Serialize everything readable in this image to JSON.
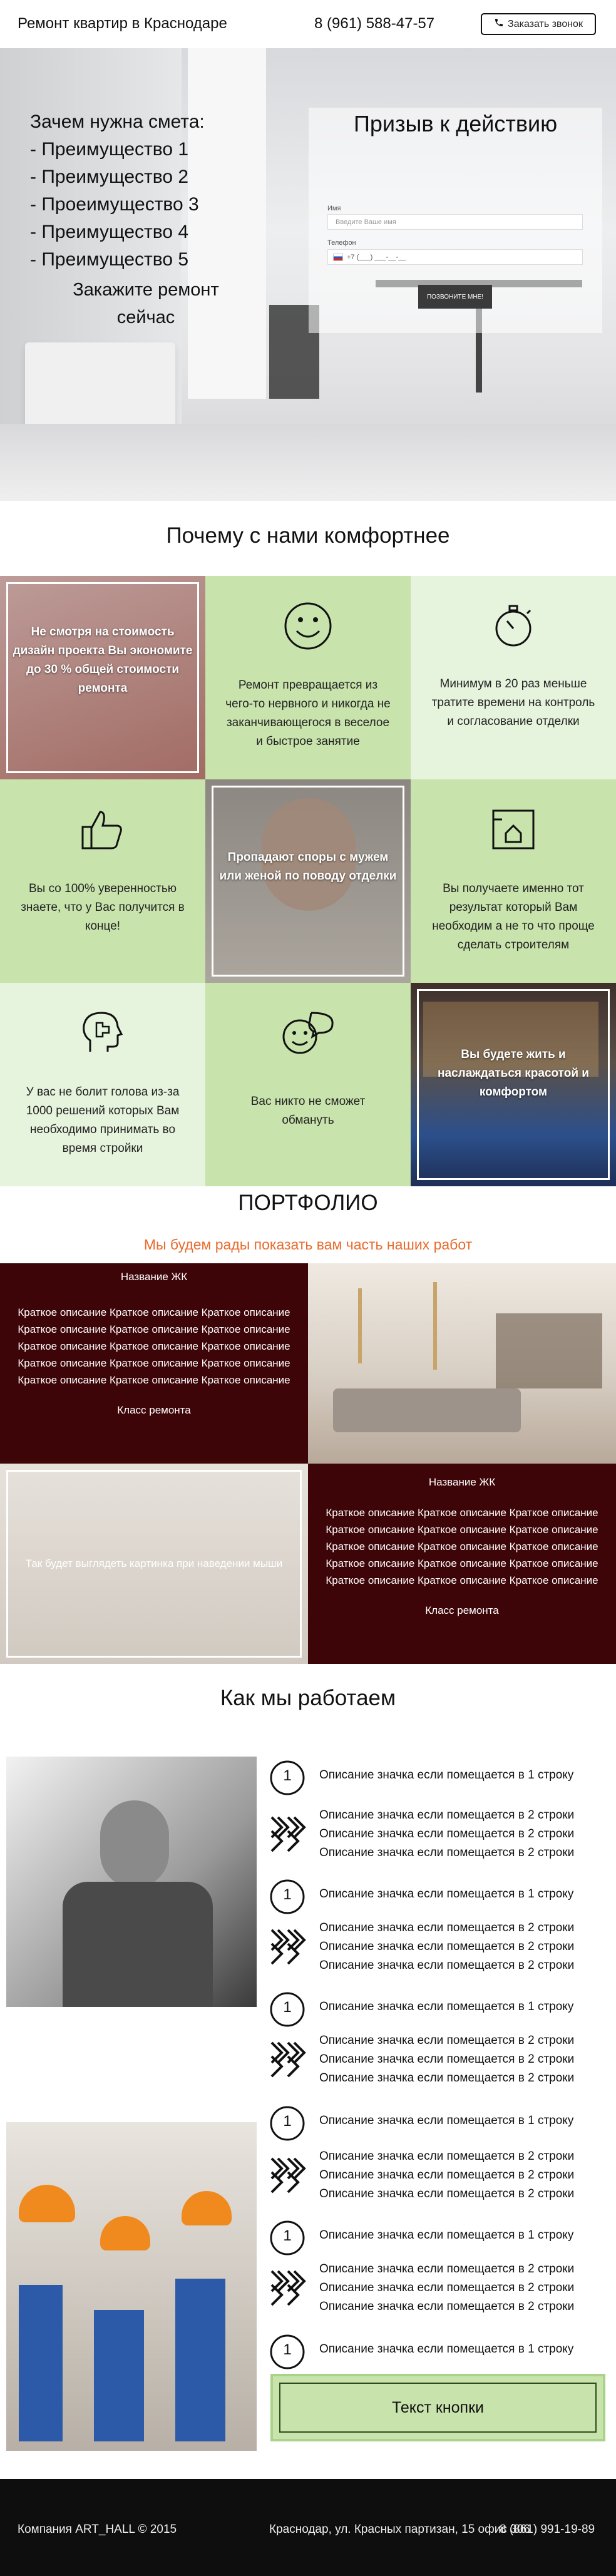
{
  "header": {
    "brand": "Ремонт квартир в Краснодаре",
    "phone": "8 (961) 588-47-57",
    "call_button": "Заказать звонок"
  },
  "hero": {
    "reasons_title": "Зачем нужна смета:",
    "reasons": [
      "- Преимущество 1",
      "- Преимущество 2",
      "- Проеимущество 3",
      "- Преимущество 4",
      "- Преимущество 5"
    ],
    "order_text": "Закажите ремонт сейчас",
    "cta": {
      "title": "Призыв к действию",
      "name_label": "Имя",
      "name_placeholder": "Введите Ваше имя",
      "phone_label": "Телефон",
      "phone_placeholder": "+7 (___) ___-__-__",
      "submit": "ПОЗВОНИТЕ МНЕ!"
    }
  },
  "why": {
    "title": "Почему с нами комфортнее",
    "cells": [
      "Не смотря на стоимость дизайн проекта Вы экономите до 30 % общей стоимости ремонта",
      "Ремонт превращается из чего-то нервного и никогда не заканчивающегося в веселое и быстрое занятие",
      "Минимум в 20 раз меньше тратите времени на контроль и согласование отделки",
      "Вы со 100% уверенностью знаете, что у Вас получится в конце!",
      "Пропадают споры с мужем или женой по поводу отделки",
      "Вы получаете именно тот результат который Вам необходим а не то что проще сделать строителям",
      "У вас не болит голова из-за 1000 решений которых Вам необходимо принимать во время стройки",
      "Вас никто не сможет обмануть",
      "Вы будете жить и наслаждаться красотой и комфортом"
    ],
    "colors": {
      "light": "#e6f3dd",
      "medium": "#c8e3ac",
      "dark_accent": "#6d1b1e"
    }
  },
  "portfolio": {
    "title": "ПОРТФОЛИО",
    "subtitle": "Мы будем рады показать вам часть наших работ",
    "items": [
      {
        "name": "Название ЖК",
        "desc_lines": [
          "Краткое описание Краткое описание Краткое описание",
          "Краткое описание Краткое описание Краткое описание",
          "Краткое описание Краткое описание Краткое описание",
          "Краткое описание Краткое описание Краткое описание",
          "Краткое описание Краткое описание Краткое описание"
        ],
        "class": "Класс ремонта"
      },
      {
        "name": "Название ЖК",
        "desc_lines": [
          "Краткое описание Краткое описание Краткое описание",
          "Краткое описание Краткое описание Краткое описание",
          "Краткое описание Краткое описание Краткое описание",
          "Краткое описание Краткое описание Краткое описание",
          "Краткое описание Краткое описание Краткое описание"
        ],
        "class": "Класс ремонта"
      }
    ],
    "hover_caption": "Так будет выглядеть картинка при наведении мыши",
    "accent": "#3d0508"
  },
  "how": {
    "title": "Как мы работаем",
    "steps": [
      {
        "icon": "number-1-icon",
        "lines": [
          "Описание значка если помещается в 1 строку"
        ]
      },
      {
        "icon": "chevron-pattern-icon",
        "lines": [
          "Описание значка если помещается в 2 строки",
          "Описание значка если помещается в 2 строки",
          "Описание значка если помещается в 2 строки"
        ]
      },
      {
        "icon": "number-1-icon",
        "lines": [
          "Описание значка если помещается в 1 строку"
        ]
      },
      {
        "icon": "chevron-pattern-icon",
        "lines": [
          "Описание значка если помещается в 2 строки",
          "Описание значка если помещается в 2 строки",
          "Описание значка если помещается в 2 строки"
        ]
      },
      {
        "icon": "number-1-icon",
        "lines": [
          "Описание значка если помещается в 1 строку"
        ]
      },
      {
        "icon": "chevron-pattern-icon",
        "lines": [
          "Описание значка если помещается в 2 строки",
          "Описание значка если помещается в 2 строки",
          "Описание значка если помещается в 2 строки"
        ]
      },
      {
        "icon": "number-1-icon",
        "lines": [
          "Описание значка если помещается в 1 строку"
        ]
      },
      {
        "icon": "chevron-pattern-icon",
        "lines": [
          "Описание значка если помещается в 2 строки",
          "Описание значка если помещается в 2 строки",
          "Описание значка если помещается в 2 строки"
        ]
      },
      {
        "icon": "number-1-icon",
        "lines": [
          "Описание значка если помещается в 1 строку"
        ]
      },
      {
        "icon": "chevron-pattern-icon",
        "lines": [
          "Описание значка если помещается в 2 строки",
          "Описание значка если помещается в 2 строки",
          "Описание значка если помещается в 2 строки"
        ]
      },
      {
        "icon": "number-1-icon",
        "lines": [
          "Описание значка если помещается в 1 строку"
        ]
      }
    ],
    "step_number": "1",
    "button": "Текст кнопки"
  },
  "footer": {
    "copyright": "Компания ART_HALL © 2015",
    "address": "Краснодар, ул. Красных партизан, 15 офис 306",
    "phone": "8 (861) 991-19-89"
  }
}
